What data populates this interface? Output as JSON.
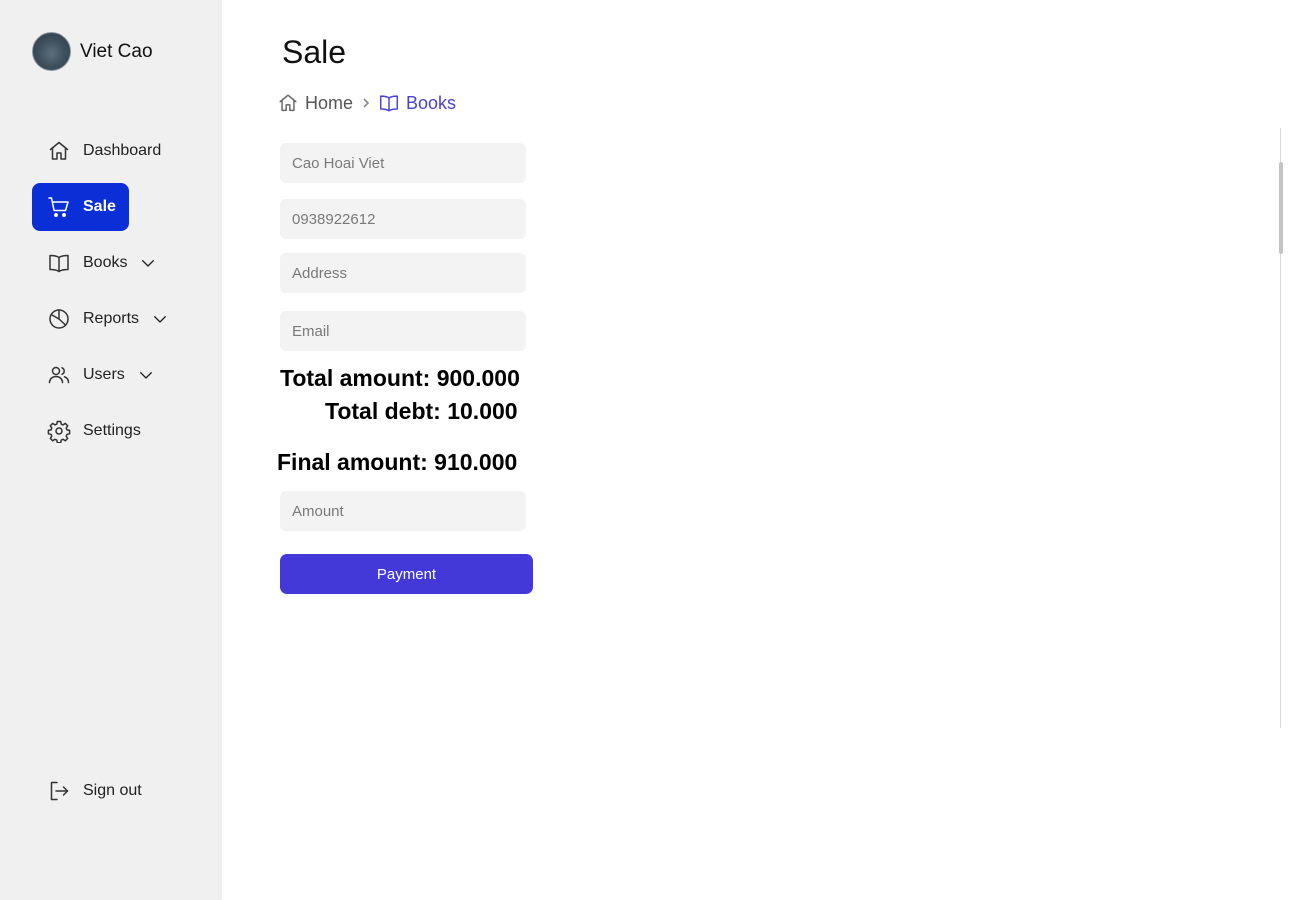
{
  "profile": {
    "name": "Viet Cao"
  },
  "sidebar": {
    "items": [
      {
        "label": "Dashboard",
        "icon": "home-icon"
      },
      {
        "label": "Sale",
        "icon": "cart-icon",
        "active": true
      },
      {
        "label": "Books",
        "icon": "book-icon",
        "expandable": true
      },
      {
        "label": "Reports",
        "icon": "pie-chart-icon",
        "expandable": true
      },
      {
        "label": "Users",
        "icon": "users-icon",
        "expandable": true
      },
      {
        "label": "Settings",
        "icon": "gear-icon"
      }
    ],
    "signout": {
      "label": "Sign out",
      "icon": "sign-out-icon"
    }
  },
  "page": {
    "title": "Sale"
  },
  "breadcrumb": {
    "home": "Home",
    "current": "Books"
  },
  "form": {
    "name": {
      "value": "",
      "placeholder": "Cao Hoai Viet"
    },
    "phone": {
      "value": "",
      "placeholder": "0938922612"
    },
    "address": {
      "value": "",
      "placeholder": "Address"
    },
    "email": {
      "value": "",
      "placeholder": "Email"
    },
    "amount": {
      "value": "",
      "placeholder": "Amount"
    }
  },
  "totals": {
    "total_amount": "Total amount: 900.000",
    "total_debt": "Total debt: 10.000",
    "final_amount": "Final amount: 910.000"
  },
  "payment_button": {
    "label": "Payment"
  },
  "colors": {
    "active_nav": "#0b2fd6",
    "accent": "#4338d8",
    "breadcrumb_active": "#4a43cf",
    "sidebar_bg": "#f0f0f0"
  }
}
